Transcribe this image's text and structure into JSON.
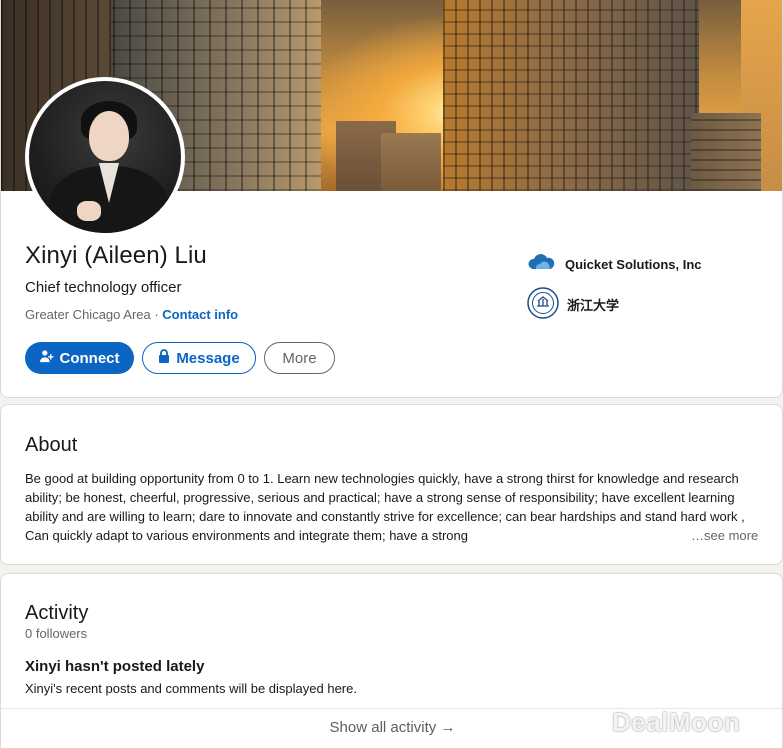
{
  "profile": {
    "name": "Xinyi (Aileen) Liu",
    "headline": "Chief technology officer",
    "location": "Greater Chicago Area",
    "separator": " · ",
    "contact_info": "Contact info",
    "actions": {
      "connect": "Connect",
      "message": "Message",
      "more": "More"
    },
    "organizations": [
      {
        "name": "Quicket Solutions, Inc",
        "icon": "company-cloud-logo"
      },
      {
        "name": "浙江大学",
        "icon": "university-seal-logo"
      }
    ]
  },
  "about": {
    "title": "About",
    "text": "Be good at building opportunity from 0 to 1. Learn new technologies quickly, have a strong thirst for knowledge and research ability; be honest, cheerful, progressive, serious and practical; have a strong sense of responsibility; have excellent learning ability and are willing to learn; dare to innovate and constantly strive for excellence; can bear hardships and stand hard work , Can quickly adapt to various environments and integrate them; have a strong",
    "see_more": "…see more"
  },
  "activity": {
    "title": "Activity",
    "followers": "0 followers",
    "empty_title": "Xinyi hasn't posted lately",
    "empty_subtitle": "Xinyi's recent posts and comments will be displayed here.",
    "show_all": "Show all activity",
    "arrow": "→"
  },
  "watermark": "DealMoon",
  "colors": {
    "accent": "#0a66c2",
    "page_bg": "#f4f2ee",
    "muted_text": "#666666"
  }
}
